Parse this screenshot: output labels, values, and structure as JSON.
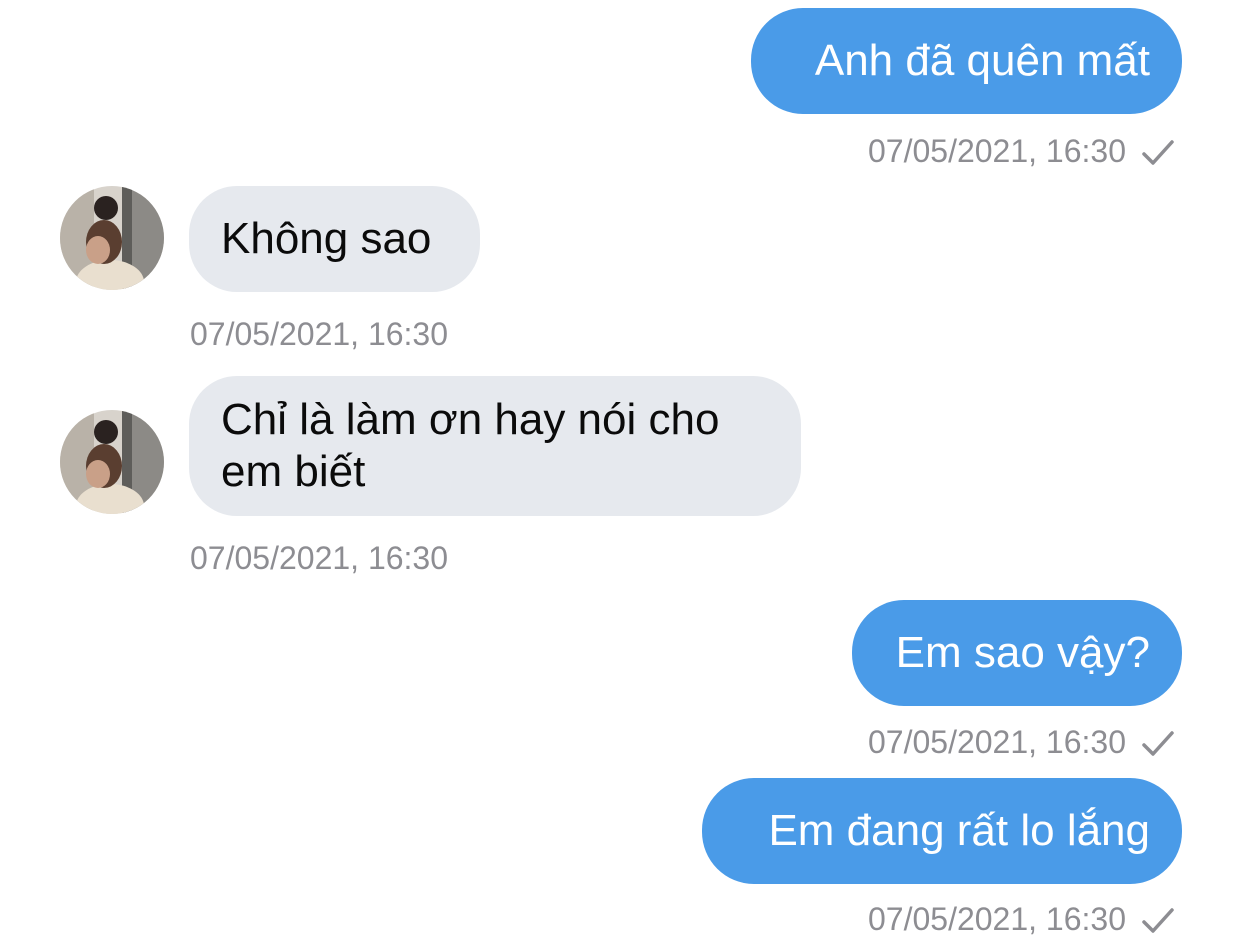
{
  "colors": {
    "outgoing_bubble": "#4a9be8",
    "incoming_bubble": "#e6e9ee",
    "timestamp": "#8d8d92"
  },
  "messages": [
    {
      "direction": "outgoing",
      "text": "Anh đã quên mất",
      "time": "07/05/2021, 16:30",
      "status_icon": "check-icon"
    },
    {
      "direction": "incoming",
      "text": "Không sao",
      "time": "07/05/2021, 16:30",
      "avatar": "contact-avatar"
    },
    {
      "direction": "incoming",
      "text": "Chỉ là làm ơn hay nói cho\nem biết",
      "time": "07/05/2021, 16:30",
      "avatar": "contact-avatar"
    },
    {
      "direction": "outgoing",
      "text": "Em sao vậy?",
      "time": "07/05/2021, 16:30",
      "status_icon": "check-icon"
    },
    {
      "direction": "outgoing",
      "text": "Em đang rất lo lắng",
      "time": "07/05/2021, 16:30",
      "status_icon": "check-icon"
    }
  ]
}
